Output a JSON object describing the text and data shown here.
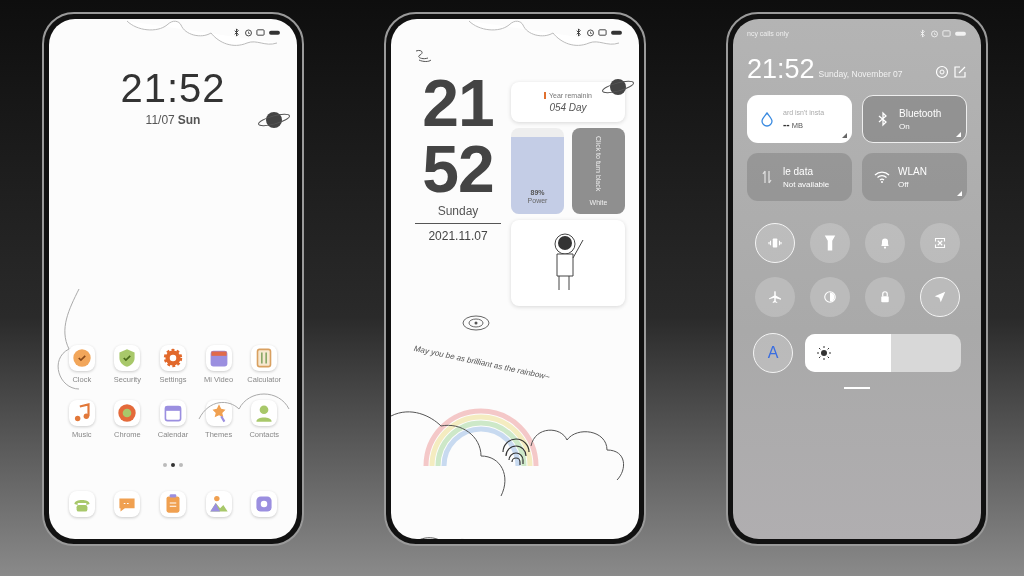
{
  "lock_screen": {
    "clock": "21:52",
    "date": "11/07",
    "weekday": "Sun",
    "apps": [
      {
        "label": "Clock",
        "kind": "clock"
      },
      {
        "label": "Security",
        "kind": "shield"
      },
      {
        "label": "Settings",
        "kind": "gear"
      },
      {
        "label": "Mi Video",
        "kind": "video"
      },
      {
        "label": "Calculator",
        "kind": "calculator"
      },
      {
        "label": "Music",
        "kind": "music"
      },
      {
        "label": "Chrome",
        "kind": "browser"
      },
      {
        "label": "Calendar",
        "kind": "calendar"
      },
      {
        "label": "Themes",
        "kind": "brush"
      },
      {
        "label": "Contacts",
        "kind": "person"
      }
    ],
    "page_dots": [
      {
        "selected": false
      },
      {
        "selected": true
      },
      {
        "selected": false
      }
    ],
    "dock": [
      {
        "kind": "phone"
      },
      {
        "kind": "chat"
      },
      {
        "kind": "clipboard"
      },
      {
        "kind": "gallery"
      },
      {
        "kind": "camera"
      }
    ]
  },
  "widget_screen": {
    "hour": "21",
    "minute": "52",
    "weekday": "Sunday",
    "date": "2021.11.07",
    "year_widget": {
      "title": "Year remainin",
      "value": "054 Day"
    },
    "power_widget": {
      "level": 0.89,
      "percent": "89%",
      "label": "Power"
    },
    "theme_widget": {
      "caption": "Click to turn black",
      "label": "White"
    },
    "motto": "May you be as brilliant as the rainbow~"
  },
  "control_center": {
    "status_text": "ncy calls only",
    "clock": "21:52",
    "date": "Sunday, November 07",
    "tiles": [
      {
        "kind": "data",
        "title": "ard isn't insta",
        "value": "--",
        "unit": "MB",
        "on": true
      },
      {
        "kind": "bluetooth",
        "title": "Bluetooth",
        "subtitle": "On",
        "on": true
      },
      {
        "kind": "mobile",
        "title": "le data",
        "subtitle": "Not available",
        "on": false
      },
      {
        "kind": "wifi",
        "title": "WLAN",
        "subtitle": "Off",
        "on": false
      }
    ],
    "toggles": [
      {
        "kind": "vibrate",
        "on": true
      },
      {
        "kind": "flashlight",
        "on": false
      },
      {
        "kind": "bell",
        "on": false
      },
      {
        "kind": "screenshot",
        "on": false
      },
      {
        "kind": "airplane",
        "on": false
      },
      {
        "kind": "reading",
        "on": false
      },
      {
        "kind": "lock",
        "on": false
      },
      {
        "kind": "location",
        "on": true
      }
    ],
    "auto_brightness": {
      "label": "A",
      "on": true
    },
    "brightness": {
      "level": 0.55
    }
  }
}
